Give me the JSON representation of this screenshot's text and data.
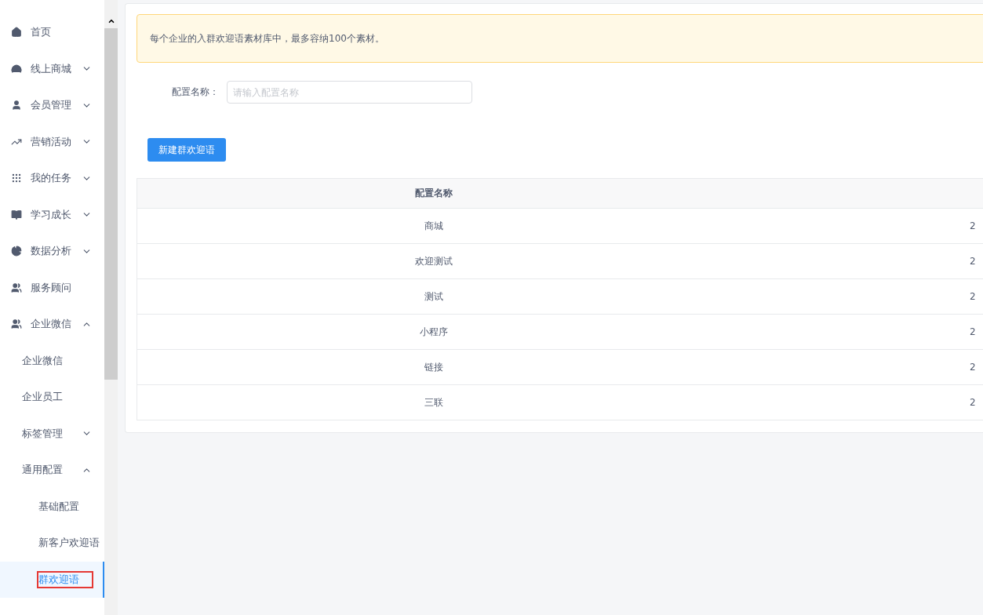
{
  "sidebar": {
    "items": [
      {
        "label": "首页",
        "selected": false
      },
      {
        "label": "线上商城",
        "expanded": false,
        "selected": false
      },
      {
        "label": "会员管理",
        "expanded": false,
        "selected": false
      },
      {
        "label": "营销活动",
        "expanded": false,
        "selected": false
      },
      {
        "label": "我的任务",
        "expanded": false,
        "selected": false
      },
      {
        "label": "学习成长",
        "expanded": false,
        "selected": false
      },
      {
        "label": "数据分析",
        "expanded": false,
        "selected": false
      },
      {
        "label": "服务顾问",
        "selected": false
      },
      {
        "label": "企业微信",
        "expanded": true,
        "selected": false,
        "children": [
          {
            "label": "企业微信",
            "selected": false
          },
          {
            "label": "企业员工",
            "selected": false
          },
          {
            "label": "标签管理",
            "expanded": false,
            "selected": false
          },
          {
            "label": "通用配置",
            "expanded": true,
            "selected": false,
            "children": [
              {
                "label": "基础配置",
                "selected": false
              },
              {
                "label": "新客户欢迎语",
                "selected": false
              },
              {
                "label": "群欢迎语",
                "selected": true
              }
            ]
          }
        ]
      }
    ]
  },
  "notice": "每个企业的入群欢迎语素材库中，最多容纳100个素材。",
  "filter": {
    "label": "配置名称：",
    "placeholder": "请输入配置名称"
  },
  "new_button": "新建群欢迎语",
  "table": {
    "columns": [
      "配置名称",
      ""
    ],
    "rows": [
      {
        "name": "商城",
        "column_2": "2"
      },
      {
        "name": "欢迎测试",
        "column_2": "2"
      },
      {
        "name": "测试",
        "column_2": "2"
      },
      {
        "name": "小程序",
        "column_2": "2"
      },
      {
        "name": "链接",
        "column_2": "2"
      },
      {
        "name": "三联",
        "column_2": "2"
      }
    ]
  }
}
